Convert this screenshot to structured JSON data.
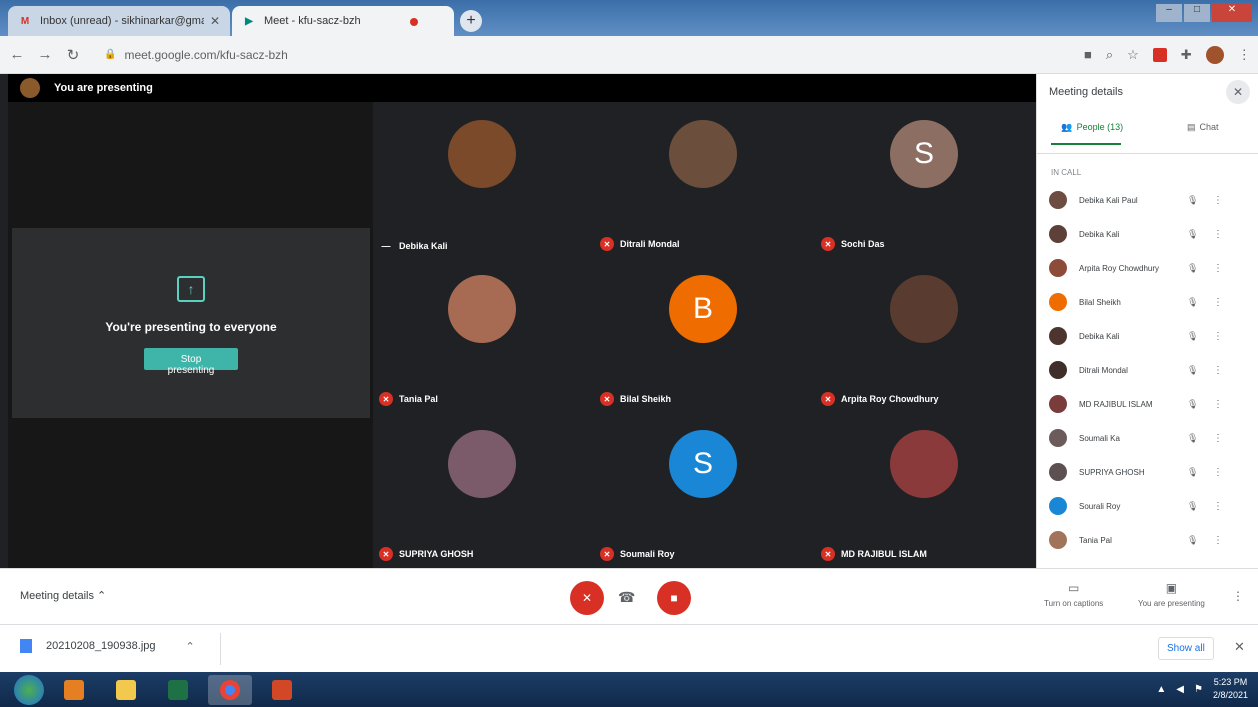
{
  "browser": {
    "tabs": [
      {
        "title": "Inbox (unread) - sikhinarkar@gmail..",
        "icon": "gmail-icon"
      },
      {
        "title": "Meet - kfu-sacz-bzh",
        "icon": "meet-icon"
      }
    ],
    "url": "meet.google.com/kfu-sacz-bzh"
  },
  "meet": {
    "presenting_label": "You are presenting",
    "present_card": {
      "message": "You're presenting to everyone",
      "stop_button": "Stop presenting"
    },
    "tiles": [
      {
        "name": "Debika Kali",
        "initial": "",
        "color": "#7a4a2a",
        "muted": false
      },
      {
        "name": "Ditrali Mondal",
        "initial": "",
        "color": "#6b4f3c",
        "muted": true
      },
      {
        "name": "Sochi Das",
        "initial": "S",
        "color": "#8d6e63",
        "muted": true
      },
      {
        "name": "Tania Pal",
        "initial": "",
        "color": "#a66b52",
        "muted": true
      },
      {
        "name": "Bilal Sheikh",
        "initial": "B",
        "color": "#ef6c00",
        "muted": true
      },
      {
        "name": "Arpita Roy Chowdhury",
        "initial": "",
        "color": "#5a3b30",
        "muted": true
      },
      {
        "name": "SUPRIYA GHOSH",
        "initial": "",
        "color": "#7b5b6a",
        "muted": true
      },
      {
        "name": "Soumali Roy",
        "initial": "S",
        "color": "#1a86d6",
        "muted": true
      },
      {
        "name": "MD RAJIBUL ISLAM",
        "initial": "",
        "color": "#8a3a3a",
        "muted": true
      }
    ]
  },
  "side_panel": {
    "title": "Meeting details",
    "tabs": [
      {
        "label": "People (13)",
        "icon": "people-icon"
      },
      {
        "label": "Chat",
        "icon": "chat-icon"
      }
    ],
    "section_label": "IN CALL",
    "people": [
      {
        "name": "Debika Kali Paul",
        "color": "#6d4c41"
      },
      {
        "name": "Debika Kali",
        "color": "#5d4037"
      },
      {
        "name": "Arpita Roy Chowdhury",
        "color": "#8d4b3a"
      },
      {
        "name": "Bilal Sheikh",
        "color": "#ef6c00"
      },
      {
        "name": "Debika Kali",
        "color": "#4e342e"
      },
      {
        "name": "Ditrali Mondal",
        "color": "#3e2f2a"
      },
      {
        "name": "MD RAJIBUL ISLAM",
        "color": "#7a3b3b"
      },
      {
        "name": "Soumali Ka",
        "color": "#6b5b5b"
      },
      {
        "name": "SUPRIYA GHOSH",
        "color": "#5c5050"
      },
      {
        "name": "Sourali Roy",
        "color": "#1a86d6"
      },
      {
        "name": "Tania Pal",
        "color": "#a1735a"
      }
    ]
  },
  "bottom_bar": {
    "meeting_details": "Meeting details ⌃",
    "captions_label": "Turn on captions",
    "presenting_label": "You are presenting"
  },
  "download_shelf": {
    "file": "20210208_190938.jpg",
    "show_all": "Show all"
  },
  "taskbar": {
    "time": "5:23 PM",
    "date": "2/8/2021"
  }
}
